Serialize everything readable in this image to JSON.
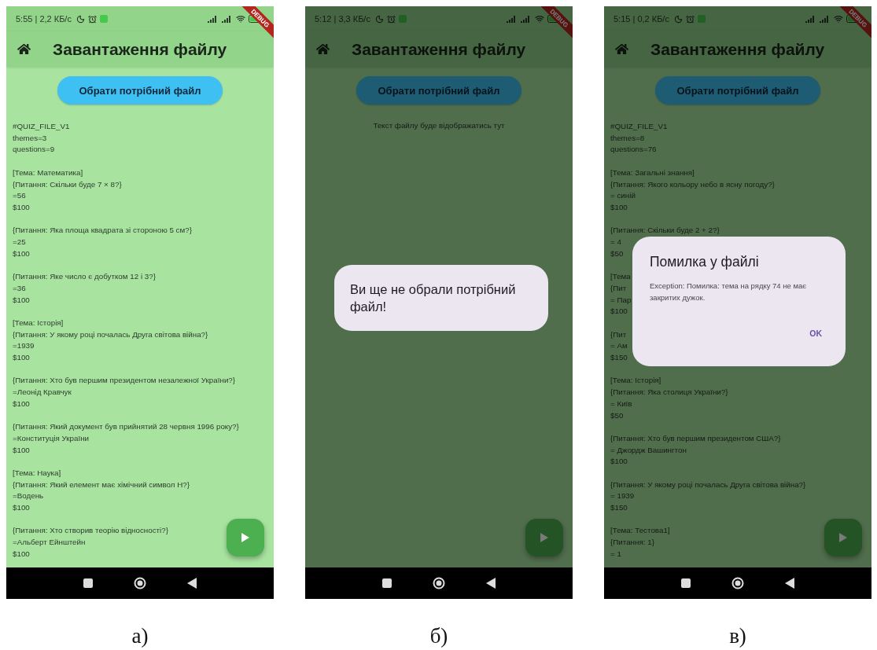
{
  "screens": [
    {
      "caption": "а)",
      "dimmed": false,
      "status": {
        "text": "5:55 | 2,2 КБ/с"
      },
      "debug_banner": "DEBUG",
      "app_bar": {
        "title": "Завантаження файлу"
      },
      "pick_button": "Обрати потрібний файл",
      "file_blocks": [
        [
          "#QUIZ_FILE_V1",
          "themes=3",
          "questions=9"
        ],
        [
          "[Тема: Математика]",
          "{Питання: Скільки буде 7 × 8?}",
          "=56",
          "$100"
        ],
        [
          "{Питання: Яка площа квадрата зі стороною 5 см?}",
          "=25",
          "$100"
        ],
        [
          "{Питання: Яке число є добутком 12 і 3?}",
          "=36",
          "$100"
        ],
        [
          "[Тема: Історія]",
          "{Питання: У якому році почалась Друга світова війна?}",
          "=1939",
          "$100"
        ],
        [
          "{Питання: Хто був першим президентом незалежної України?}",
          "=Леонід Кравчук",
          "$100"
        ],
        [
          "{Питання: Який документ був прийнятий 28 червня 1996 року?}",
          "=Конституція України",
          "$100"
        ],
        [
          "[Тема: Наука]",
          "{Питання: Який елемент має хімічний символ H?}",
          "=Водень",
          "$100"
        ],
        [
          "{Питання: Хто створив теорію відносності?}",
          "=Альберт Ейнштейн",
          "$100"
        ]
      ]
    },
    {
      "caption": "б)",
      "dimmed": true,
      "status": {
        "text": "5:12 | 3,3 КБ/с"
      },
      "debug_banner": "DEBUG",
      "app_bar": {
        "title": "Завантаження файлу"
      },
      "pick_button": "Обрати потрібний файл",
      "empty_message": "Текст файлу буде відображатись тут",
      "dialog": {
        "kind": "message",
        "text": "Ви ще не обрали потрібний файл!"
      }
    },
    {
      "caption": "в)",
      "dimmed": true,
      "status": {
        "text": "5:15 | 0,2 КБ/с"
      },
      "debug_banner": "DEBUG",
      "app_bar": {
        "title": "Завантаження файлу"
      },
      "pick_button": "Обрати потрібний файл",
      "file_blocks": [
        [
          "#QUIZ_FILE_V1",
          "themes=8",
          "questions=76"
        ],
        [
          "[Тема: Загальні знання]",
          "{Питання: Якого кольору небо в ясну погоду?}",
          "= синій",
          "$100"
        ],
        [
          "{Питання: Скільки буде 2 + 2?}",
          "= 4",
          "$50"
        ],
        [
          "[Тема",
          "{Пит",
          "= Пар",
          "$100"
        ],
        [
          "{Пит",
          "= Ам",
          "$150"
        ],
        [
          "[Тема: Історія]",
          "{Питання: Яка столиця України?}",
          "= Київ",
          "$50"
        ],
        [
          "{Питання: Хто був першим президентом США?}",
          "= Джордж Вашингтон",
          "$100"
        ],
        [
          "{Питання: У якому році почалась Друга світова війна?}",
          "= 1939",
          "$150"
        ],
        [
          "[Тема: Тестова1]",
          "{Питання: 1}",
          "= 1"
        ]
      ],
      "dialog": {
        "kind": "alert",
        "title": "Помилка у файлі",
        "text": "Exception: Помилка: тема на рядку 74 не має закритих дужок.",
        "button": "OK"
      }
    }
  ]
}
